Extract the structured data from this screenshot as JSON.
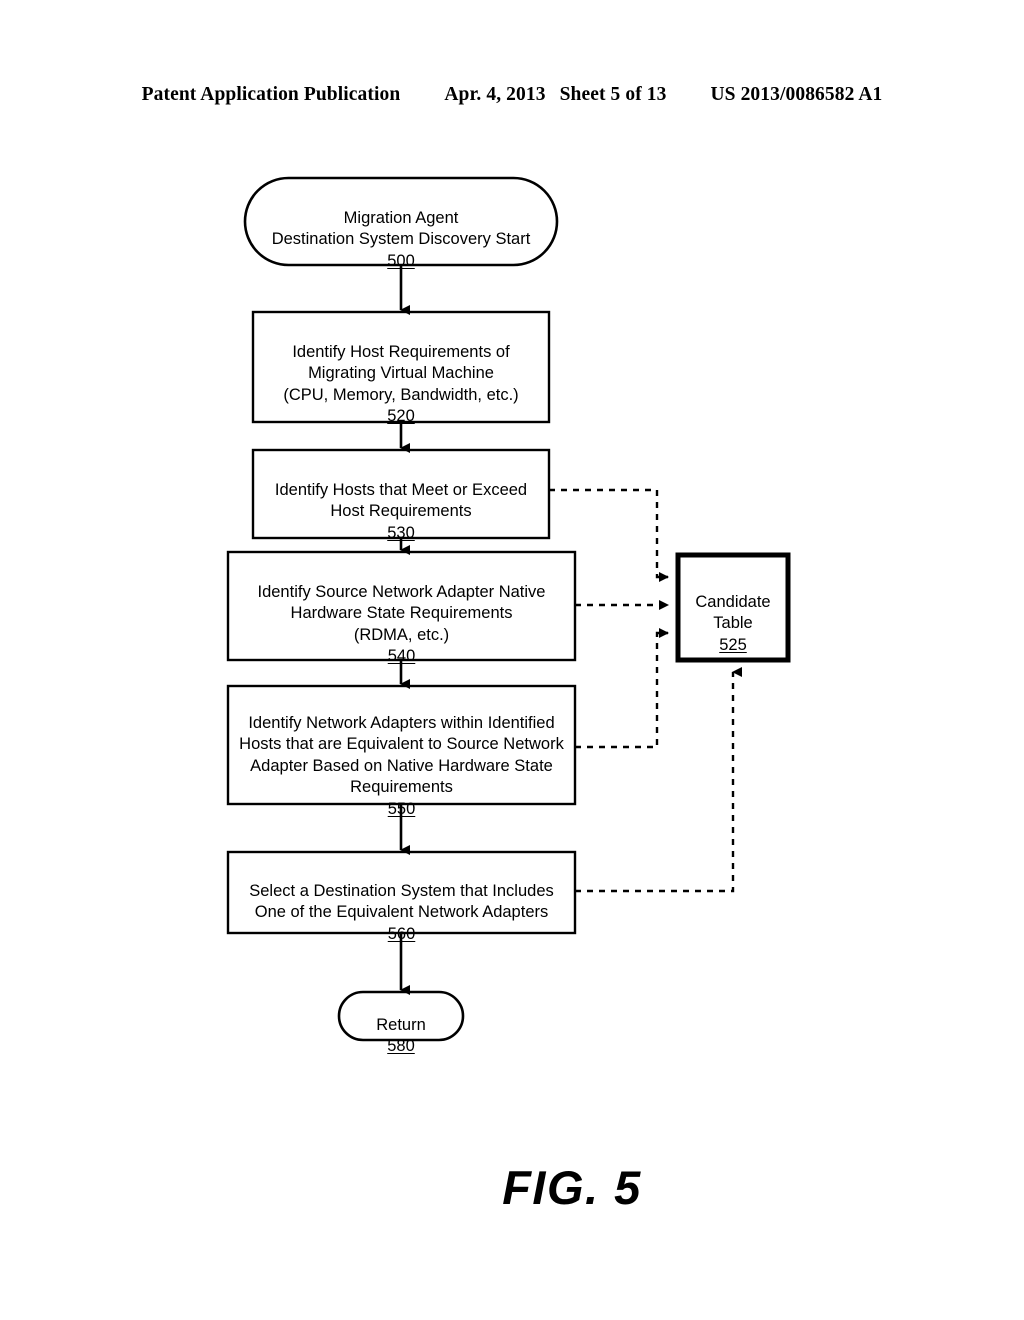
{
  "header": {
    "publication": "Patent Application Publication",
    "date": "Apr. 4, 2013",
    "sheet": "Sheet 5 of 13",
    "patent_number": "US 2013/0086582 A1"
  },
  "figure": {
    "caption": "FIG. 5",
    "nodes": {
      "start": {
        "shape": "rounded-terminator",
        "text": "Migration Agent\nDestination System Discovery Start",
        "ref": "500"
      },
      "step520": {
        "shape": "rectangle",
        "text": "Identify Host Requirements of\nMigrating Virtual Machine\n(CPU, Memory, Bandwidth, etc.)",
        "ref": "520"
      },
      "step530": {
        "shape": "rectangle",
        "text": "Identify Hosts that Meet or Exceed\nHost Requirements",
        "ref": "530"
      },
      "step540": {
        "shape": "rectangle",
        "text": "Identify Source Network Adapter Native\nHardware State Requirements\n(RDMA, etc.)",
        "ref": "540"
      },
      "step550": {
        "shape": "rectangle",
        "text": "Identify Network Adapters within Identified\nHosts that are Equivalent to Source Network\nAdapter Based on Native Hardware State\nRequirements",
        "ref": "550"
      },
      "step560": {
        "shape": "rectangle",
        "text": "Select a Destination System that Includes\nOne of the Equivalent Network Adapters",
        "ref": "560"
      },
      "candidate_table": {
        "shape": "rectangle-bold",
        "text": "Candidate\nTable",
        "ref": "525"
      },
      "return": {
        "shape": "rounded-terminator",
        "text": "Return",
        "ref": "580"
      }
    },
    "connectors": [
      {
        "from": "start",
        "to": "step520",
        "style": "solid",
        "arrow": "down"
      },
      {
        "from": "step520",
        "to": "step530",
        "style": "solid",
        "arrow": "down"
      },
      {
        "from": "step530",
        "to": "step540",
        "style": "solid",
        "arrow": "down"
      },
      {
        "from": "step540",
        "to": "step550",
        "style": "solid",
        "arrow": "down"
      },
      {
        "from": "step550",
        "to": "step560",
        "style": "solid",
        "arrow": "down"
      },
      {
        "from": "step560",
        "to": "return",
        "style": "solid",
        "arrow": "down"
      },
      {
        "from": "step530",
        "to": "candidate_table",
        "style": "dashed",
        "arrow": "right"
      },
      {
        "from": "step540",
        "to": "candidate_table",
        "style": "dashed",
        "arrow": "right"
      },
      {
        "from": "step550",
        "to": "candidate_table",
        "style": "dashed",
        "arrow": "right"
      },
      {
        "from": "step560",
        "to": "candidate_table",
        "style": "dashed",
        "arrow": "up"
      }
    ]
  },
  "colors": {
    "ink": "#000000",
    "paper": "#ffffff"
  }
}
